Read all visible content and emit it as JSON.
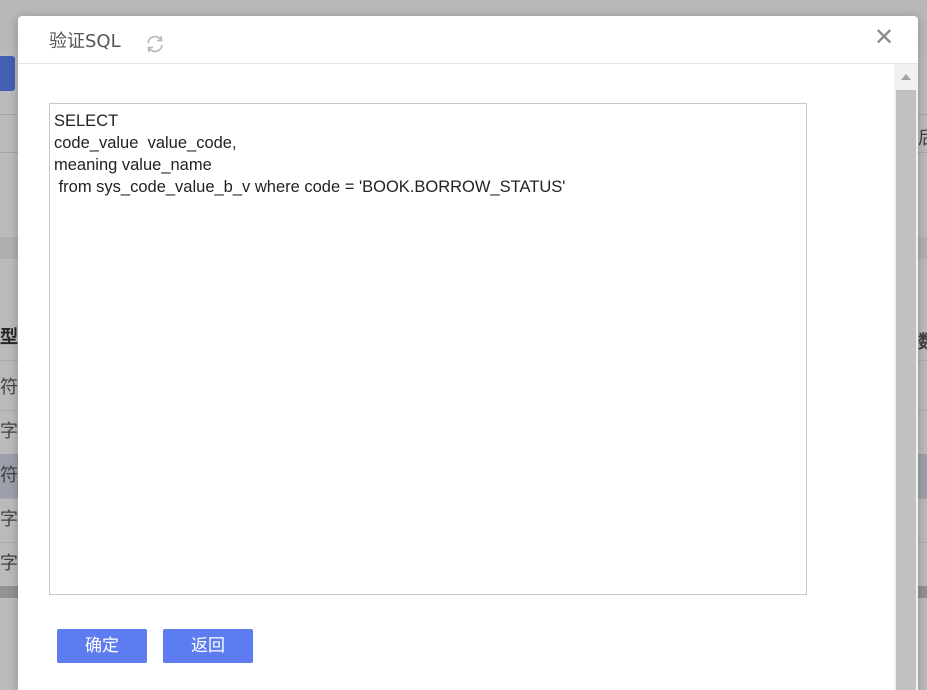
{
  "background": {
    "left_column_chars": [
      "型",
      "符",
      "字",
      "符",
      "字",
      "字"
    ],
    "right_column_chars": [
      "后",
      "数"
    ]
  },
  "modal": {
    "title": "验证SQL",
    "refresh_icon": "refresh-icon",
    "close_label": "✕",
    "sql_text": "SELECT\ncode_value  value_code,\nmeaning value_name\n from sys_code_value_b_v where code = 'BOOK.BORROW_STATUS'",
    "confirm_label": "确定",
    "back_label": "返回"
  },
  "colors": {
    "primary_button": "#5c7cf0",
    "overlay": "#b9b9b9"
  }
}
